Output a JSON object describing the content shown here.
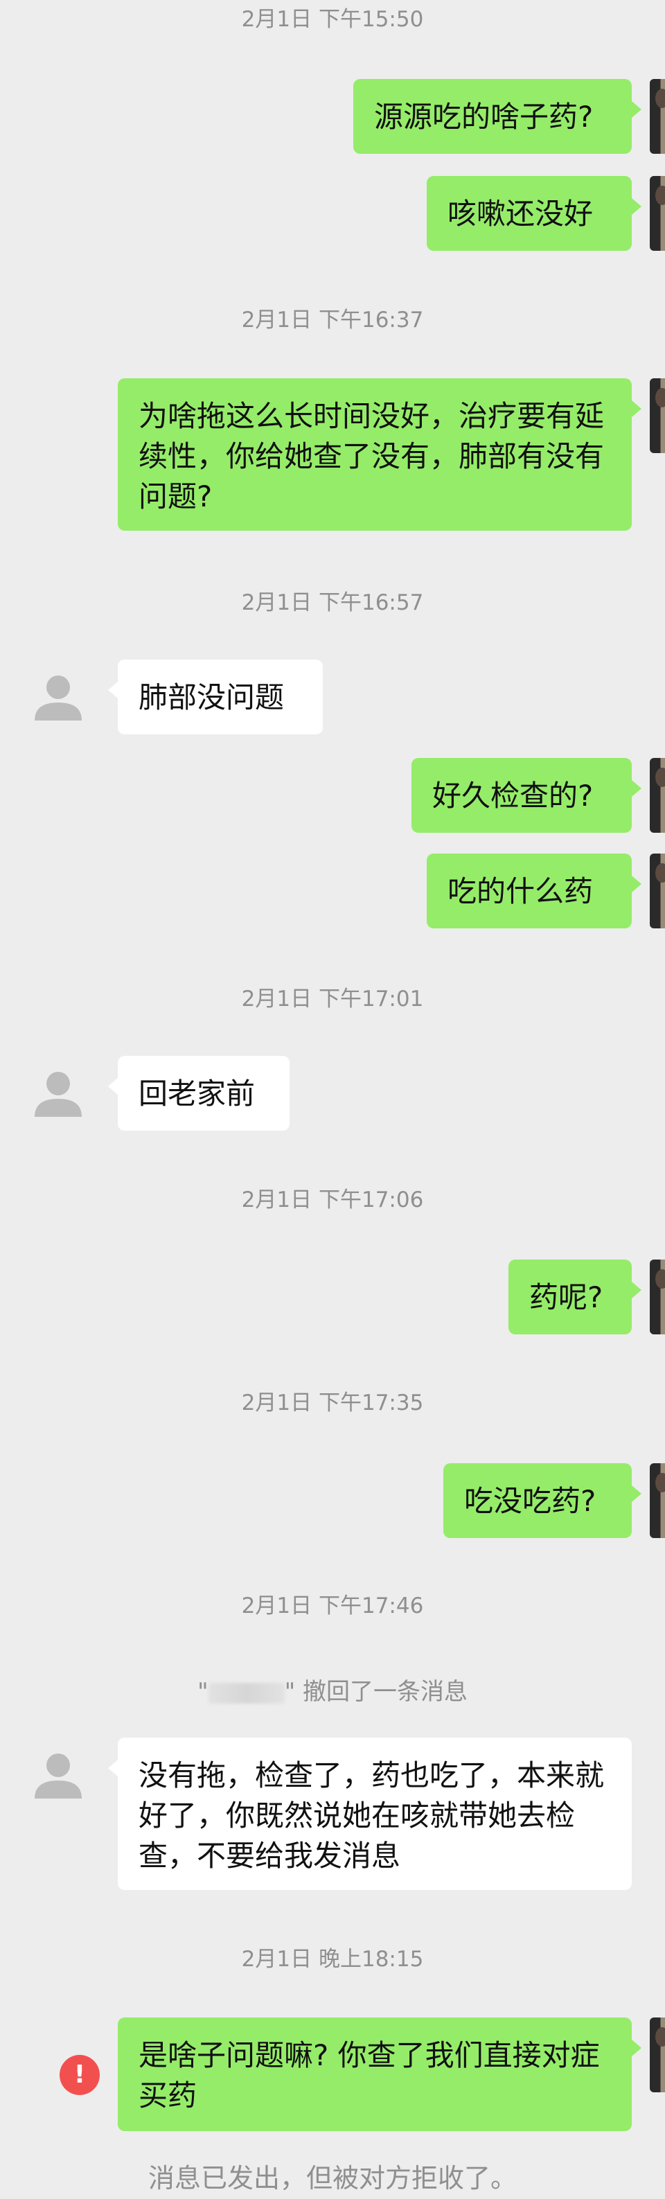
{
  "timestamps": [
    "2月1日 下午15:50",
    "2月1日 下午16:37",
    "2月1日 下午16:57",
    "2月1日 下午17:01",
    "2月1日 下午17:06",
    "2月1日 下午17:35",
    "2月1日 下午17:46",
    "2月1日 晚上18:15"
  ],
  "messages": [
    {
      "from": "me",
      "text": "源源吃的啥子药?"
    },
    {
      "from": "me",
      "text": "咳嗽还没好"
    },
    {
      "from": "me",
      "text": "为啥拖这么长时间没好，治疗要有延续性，你给她查了没有，肺部有没有问题?"
    },
    {
      "from": "them",
      "text": "肺部没问题"
    },
    {
      "from": "me",
      "text": "好久检查的?"
    },
    {
      "from": "me",
      "text": "吃的什么药"
    },
    {
      "from": "them",
      "text": "回老家前"
    },
    {
      "from": "me",
      "text": "药呢?"
    },
    {
      "from": "me",
      "text": "吃没吃药?"
    },
    {
      "from": "them",
      "text": "没有拖，检查了，药也吃了，本来就好了，你既然说她在咳就带她去检查，不要给我发消息"
    },
    {
      "from": "me",
      "text": "是啥子问题嘛? 你查了我们直接对症买药"
    }
  ],
  "recall_notice": {
    "open_quote": "\"",
    "close_quote": "\"",
    "text": "撤回了一条消息"
  },
  "error_icon_glyph": "!",
  "reject_notice": "消息已发出，但被对方拒收了。",
  "colors": {
    "background": "#ededed",
    "my_bubble": "#95ec69",
    "their_bubble": "#ffffff",
    "timestamp_text": "#8f8f8f",
    "error_red": "#f2504f"
  },
  "icons": {
    "their_avatar": "default-person-icon",
    "error": "exclamation-circle-icon"
  }
}
